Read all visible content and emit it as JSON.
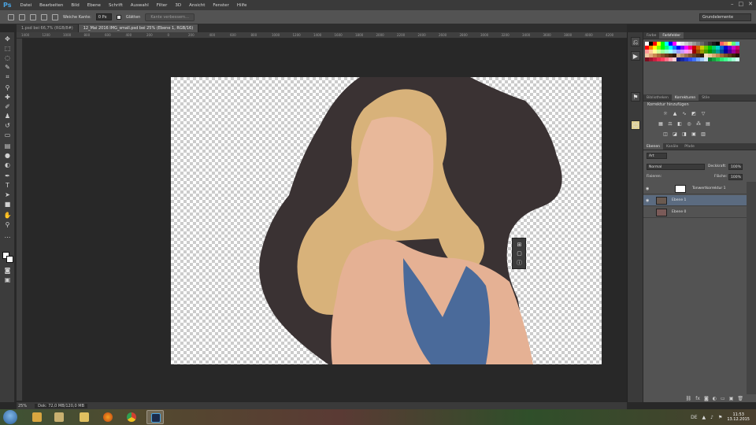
{
  "app": {
    "logo": "Ps"
  },
  "menu": [
    "Datei",
    "Bearbeiten",
    "Bild",
    "Ebene",
    "Schrift",
    "Auswahl",
    "Filter",
    "3D",
    "Ansicht",
    "Fenster",
    "Hilfe"
  ],
  "window_controls": {
    "minimize": "–",
    "maximize": "□",
    "close": "✕"
  },
  "options_bar": {
    "edge_label": "Weiche Kante:",
    "edge_value": "0 Px",
    "smooth_label": "Glätten",
    "refine_button": "Kante verbessern..."
  },
  "workspace": "Grundelemente",
  "tabs": [
    {
      "label": "1.psd bei 66,7% (RGB/8#)",
      "active": false
    },
    {
      "label": "12_Mai 2016 IMG_small.psd bei 25% (Ebene 1, RGB/16)",
      "active": true
    }
  ],
  "ruler_marks": [
    "1400",
    "1200",
    "1000",
    "800",
    "600",
    "400",
    "200",
    "0",
    "200",
    "400",
    "600",
    "800",
    "1000",
    "1200",
    "1400",
    "1600",
    "1800",
    "2000",
    "2200",
    "2400",
    "2600",
    "2800",
    "3000",
    "3200",
    "3400",
    "3600",
    "3800",
    "4000",
    "4200"
  ],
  "status": {
    "zoom": "25%",
    "doc": "Dok: 72,0 MB/120,0 MB"
  },
  "panels": {
    "color_tabs": [
      "Farbe",
      "Farbfelder"
    ],
    "adjust_tabs": [
      "Bibliotheken",
      "Korrekturen",
      "Stile"
    ],
    "adjust_title": "Korrektur hinzufügen",
    "layer_tabs": [
      "Ebenen",
      "Kanäle",
      "Pfade"
    ],
    "kind_filter": "Art",
    "blend_mode": "Normal",
    "opacity_label": "Deckkraft:",
    "opacity_value": "100%",
    "lock_label": "Fixieren:",
    "fill_label": "Fläche:",
    "fill_value": "100%",
    "layers": [
      {
        "name": "Tonwertkorrektur 1",
        "selected": false,
        "type": "adjustment"
      },
      {
        "name": "Ebene 1",
        "selected": true,
        "type": "image"
      },
      {
        "name": "Ebene 0",
        "selected": false,
        "type": "image"
      }
    ]
  },
  "colors": {
    "swatches": [
      "#ffffff",
      "#000000",
      "#ff0000",
      "#ffff00",
      "#00ff00",
      "#00ffff",
      "#0000ff",
      "#ff00ff",
      "#ffffff",
      "#e6e6e6",
      "#cccccc",
      "#b3b3b3",
      "#999999",
      "#808080",
      "#666666",
      "#4d4d4d",
      "#333333",
      "#1a1a1a",
      "#000000",
      "#ff5c5c",
      "#ffa05c",
      "#fff05c",
      "#5cff7a",
      "#5cd6ff",
      "#ff0000",
      "#ff8000",
      "#ffff00",
      "#80ff00",
      "#00ff00",
      "#00ff80",
      "#00ffff",
      "#0080ff",
      "#0000ff",
      "#8000ff",
      "#ff00ff",
      "#ff0080",
      "#cc0000",
      "#cc6600",
      "#cccc00",
      "#66cc00",
      "#00cc00",
      "#00cc66",
      "#00cccc",
      "#0066cc",
      "#0000cc",
      "#6600cc",
      "#cc00cc",
      "#cc0066",
      "#ff9999",
      "#ffcc99",
      "#ffff99",
      "#ccff99",
      "#99ff99",
      "#99ffcc",
      "#99ffff",
      "#99ccff",
      "#9999ff",
      "#cc99ff",
      "#ff99ff",
      "#ff99cc",
      "#990000",
      "#994c00",
      "#999900",
      "#4c9900",
      "#009900",
      "#00994c",
      "#009999",
      "#004c99",
      "#000099",
      "#4c0099",
      "#990099",
      "#99004c",
      "#f2c8a0",
      "#e0a878",
      "#c98850",
      "#a86a38",
      "#8a5028",
      "#6a3a1c",
      "#4a2810",
      "#2e1808",
      "#d4b08c",
      "#b8906c",
      "#9c7050",
      "#805438",
      "#643c24",
      "#482814",
      "#2c1808",
      "#f8e0c0",
      "#ecc898",
      "#d8a870",
      "#c08850",
      "#a06838",
      "#805028",
      "#603818",
      "#402408",
      "#201004",
      "#7a1020",
      "#a01830",
      "#c82040",
      "#e83050",
      "#ff4060",
      "#ff7088",
      "#ffa0b0",
      "#ffd0d8",
      "#101a7a",
      "#1828a0",
      "#2038c8",
      "#3050e8",
      "#4070ff",
      "#70a0ff",
      "#a0c8ff",
      "#d0e8ff",
      "#107a30",
      "#18a040",
      "#20c850",
      "#30e870",
      "#40ff90",
      "#70ffb0",
      "#a0ffd0",
      "#d0fff0"
    ],
    "fg": "#ffffff",
    "bg": "#ffffff",
    "backdrop": "#3a3233",
    "skin": "#e8b89a",
    "hair": "#d8b27a",
    "dress": "#4a6a9a"
  },
  "tray": {
    "lang": "DE",
    "time": "11:53",
    "date": "13.12.2015"
  }
}
